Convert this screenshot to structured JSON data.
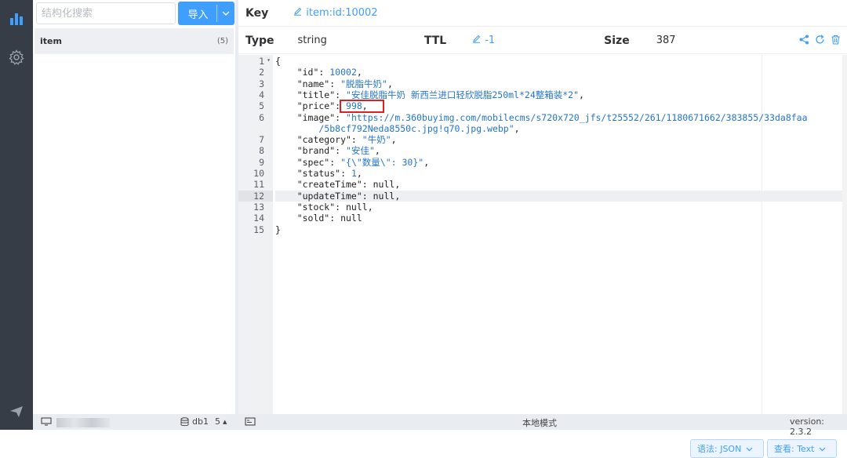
{
  "left": {
    "search_placeholder": "结构化搜索",
    "import_label": "导入",
    "tree": [
      {
        "name": "item",
        "count": "(5)"
      }
    ]
  },
  "key_bar": {
    "label": "Key",
    "value": "item:id:10002"
  },
  "type_bar": {
    "type_label": "Type",
    "type_value": "string",
    "ttl_label": "TTL",
    "ttl_value": "-1",
    "size_label": "Size",
    "size_value": "387"
  },
  "editor": {
    "line_numbers": [
      "1",
      "2",
      "3",
      "4",
      "5",
      "6",
      "",
      "7",
      "8",
      "9",
      "10",
      "11",
      "12",
      "13",
      "14",
      "15"
    ],
    "lines": [
      [
        {
          "t": "{"
        }
      ],
      [
        {
          "t": "    \"id\": "
        },
        {
          "t": "10002",
          "c": "n"
        },
        {
          "t": ","
        }
      ],
      [
        {
          "t": "    \"name\": "
        },
        {
          "t": "\"脱脂牛奶\"",
          "c": "s"
        },
        {
          "t": ","
        }
      ],
      [
        {
          "t": "    \"title\": "
        },
        {
          "t": "\"安佳脱脂牛奶 新西兰进口轻欣脱脂250ml*24整箱装*2\"",
          "c": "s"
        },
        {
          "t": ","
        }
      ],
      [
        {
          "t": "    \"price\": "
        },
        {
          "t": "998",
          "c": "n"
        },
        {
          "t": ","
        }
      ],
      [
        {
          "t": "    \"image\": "
        },
        {
          "t": "\"https://m.360buyimg.com/mobilecms/s720x720_jfs/t25552/261/1180671662/383855/33da8faa",
          "c": "s"
        }
      ],
      [
        {
          "t": "        "
        },
        {
          "t": "/5b8cf792Neda8550c.jpg!q70.jpg.webp\"",
          "c": "s"
        },
        {
          "t": ","
        }
      ],
      [
        {
          "t": "    \"category\": "
        },
        {
          "t": "\"牛奶\"",
          "c": "s"
        },
        {
          "t": ","
        }
      ],
      [
        {
          "t": "    \"brand\": "
        },
        {
          "t": "\"安佳\"",
          "c": "s"
        },
        {
          "t": ","
        }
      ],
      [
        {
          "t": "    \"spec\": "
        },
        {
          "t": "\"{\\\"数量\\\": 30}\"",
          "c": "s"
        },
        {
          "t": ","
        }
      ],
      [
        {
          "t": "    \"status\": "
        },
        {
          "t": "1",
          "c": "n"
        },
        {
          "t": ","
        }
      ],
      [
        {
          "t": "    \"createTime\": null,"
        }
      ],
      [
        {
          "t": "    \"updateTime\": null,"
        }
      ],
      [
        {
          "t": "    \"stock\": null,"
        }
      ],
      [
        {
          "t": "    \"sold\": null"
        }
      ],
      [
        {
          "t": "}"
        }
      ]
    ],
    "highlighted_line": 12
  },
  "buttons": {
    "syntax_label": "语法: JSON",
    "view_label": "查看: Text"
  },
  "status_bar": {
    "db_label": "db1",
    "db_count": "5",
    "mode_text": "本地模式",
    "version_text": "version: 2.3.2"
  },
  "icons": [
    "bar-chart-icon",
    "settings-icon",
    "send-icon",
    "share-icon",
    "refresh-icon",
    "delete-icon",
    "edit-icon",
    "database-icon",
    "monitor-icon",
    "terminal-icon"
  ],
  "colors": {
    "accent": "#409eff",
    "rail": "#363d46",
    "highlight_box": "#e02020"
  }
}
